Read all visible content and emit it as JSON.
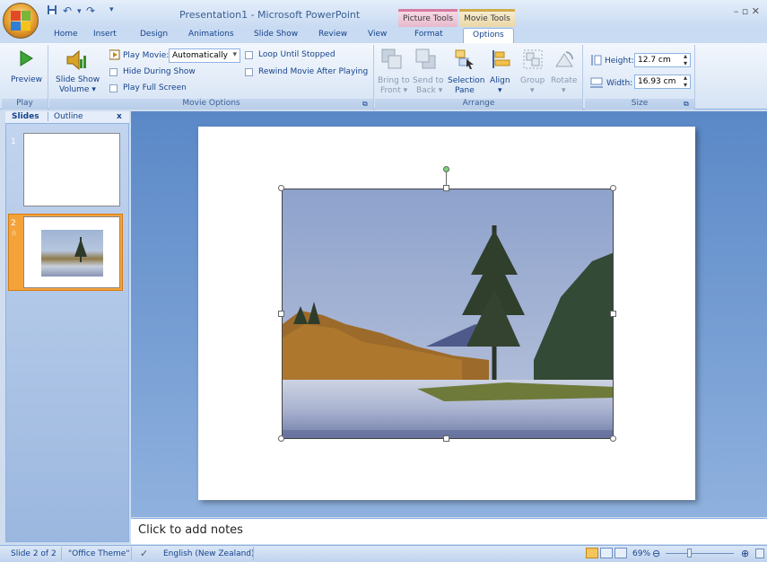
{
  "window": {
    "title": "Presentation1 - Microsoft PowerPoint",
    "context_tabs": [
      "Picture Tools",
      "Movie Tools"
    ],
    "controls": "–  ▫  ✕"
  },
  "quick_access": {
    "save_icon": "save-icon",
    "undo_icon": "undo-icon",
    "redo_icon": "redo-icon",
    "more": "▾"
  },
  "tabs": [
    "Home",
    "Insert",
    "Design",
    "Animations",
    "Slide Show",
    "Review",
    "View",
    "Format",
    "Options"
  ],
  "active_tab": "Options",
  "ribbon": {
    "play": {
      "preview_label": "Preview",
      "group_label": "Play"
    },
    "movie_options": {
      "slide_show_volume": "Slide Show",
      "slide_show_volume_2": "Volume ▾",
      "play_movie_label": "Play Movie:",
      "play_movie_value": "Automatically",
      "hide_during_show": "Hide During Show",
      "play_full_screen": "Play Full Screen",
      "loop_until_stopped": "Loop Until Stopped",
      "rewind_movie": "Rewind Movie After Playing",
      "group_label": "Movie Options"
    },
    "arrange": {
      "bring_to_front_1": "Bring to",
      "bring_to_front_2": "Front ▾",
      "send_to_back_1": "Send to",
      "send_to_back_2": "Back ▾",
      "selection_pane_1": "Selection",
      "selection_pane_2": "Pane",
      "align": "Align",
      "align_2": "▾",
      "group": "Group",
      "group_2": "▾",
      "rotate": "Rotate",
      "rotate_2": "▾",
      "group_label": "Arrange"
    },
    "size": {
      "height_label": "Height:",
      "height_value": "12.7 cm",
      "width_label": "Width:",
      "width_value": "16.93 cm",
      "group_label": "Size"
    }
  },
  "left_pane": {
    "tabs": [
      "Slides",
      "Outline"
    ],
    "close": "x",
    "slide_numbers": [
      "1",
      "2"
    ]
  },
  "notes_placeholder": "Click to add notes",
  "status": {
    "slide": "Slide 2 of 2",
    "theme": "\"Office Theme\"",
    "language": "English (New Zealand)",
    "zoom": "69%"
  }
}
